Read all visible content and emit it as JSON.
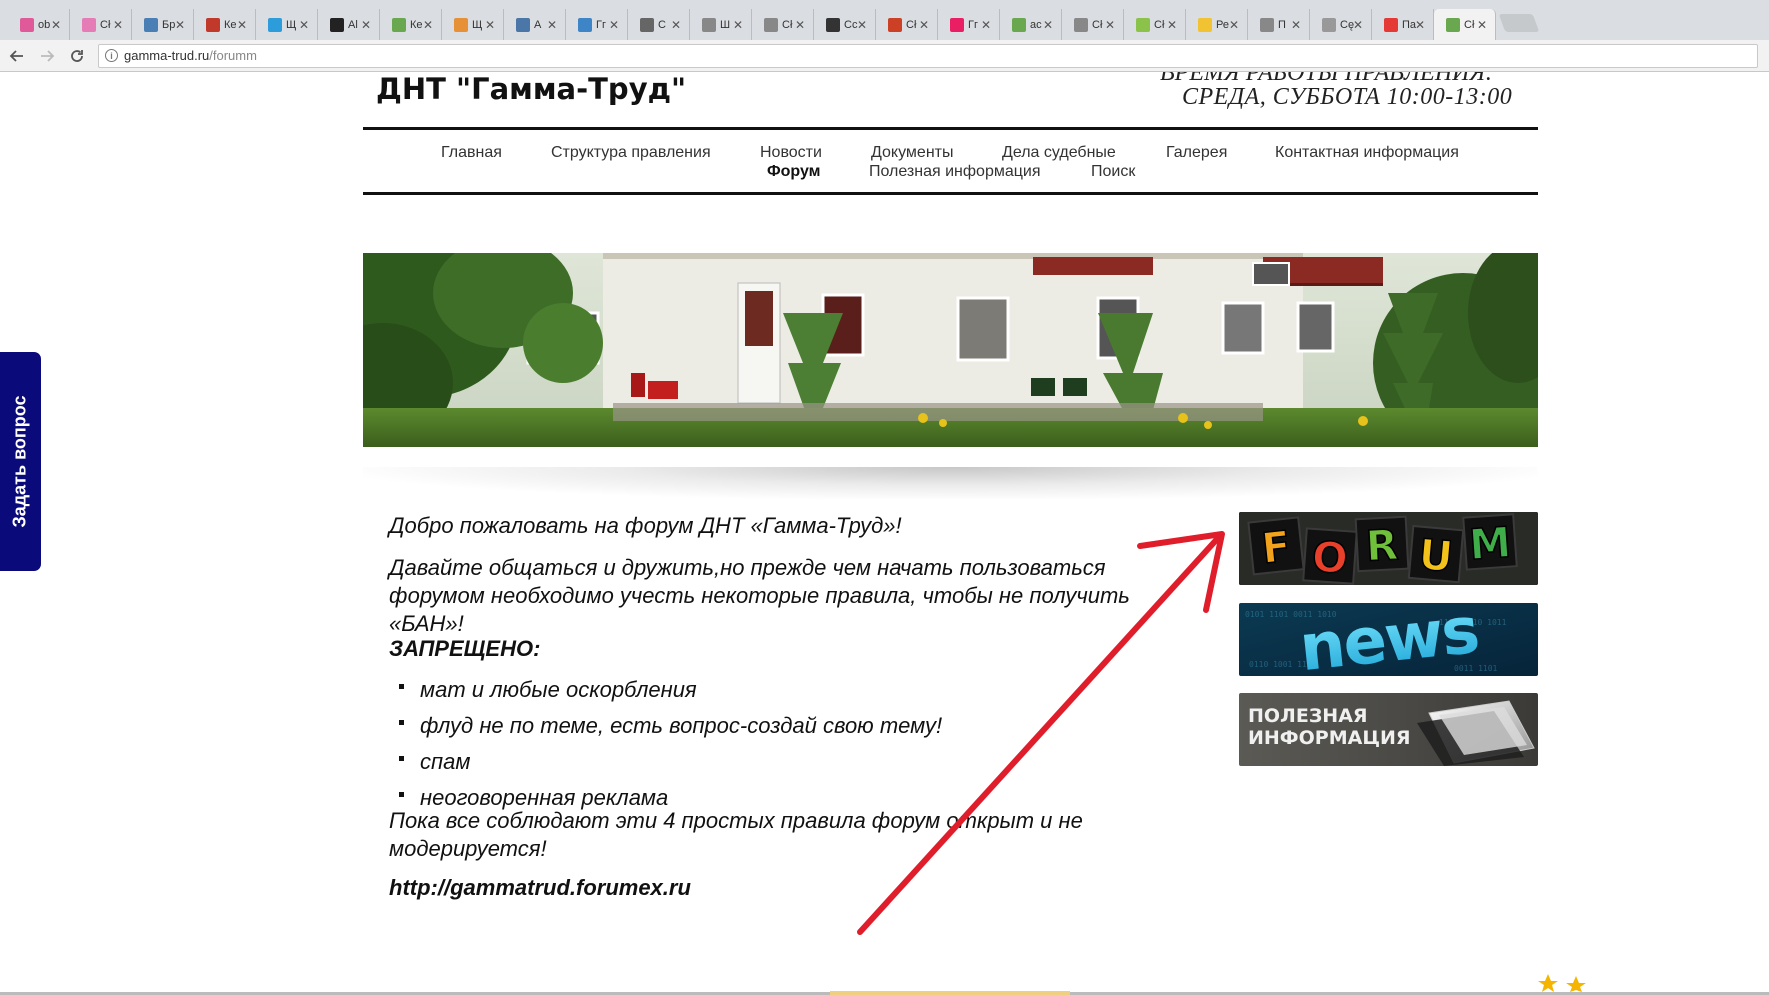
{
  "browser": {
    "tabs": [
      {
        "title": "ob",
        "color": "#e05a9a"
      },
      {
        "title": "Cł",
        "color": "#e57cb6"
      },
      {
        "title": "Бр",
        "color": "#4a7fb5"
      },
      {
        "title": "Ке",
        "color": "#c0392b"
      },
      {
        "title": "Щ",
        "color": "#2d9cdb"
      },
      {
        "title": "Al",
        "color": "#222222"
      },
      {
        "title": "Ке",
        "color": "#6aa84f"
      },
      {
        "title": "Щ",
        "color": "#e69138"
      },
      {
        "title": "А",
        "color": "#4a76a8"
      },
      {
        "title": "Гг",
        "color": "#3d85c6"
      },
      {
        "title": "С",
        "color": "#666666"
      },
      {
        "title": "Ш",
        "color": "#888888"
      },
      {
        "title": "Cł",
        "color": "#888888"
      },
      {
        "title": "Cc",
        "color": "#333333"
      },
      {
        "title": "Cł",
        "color": "#cc4125"
      },
      {
        "title": "Гг",
        "color": "#e91e63"
      },
      {
        "title": "ac",
        "color": "#6aa84f"
      },
      {
        "title": "Cł",
        "color": "#888888"
      },
      {
        "title": "Cł",
        "color": "#8bc34a"
      },
      {
        "title": "Ре",
        "color": "#f1c232"
      },
      {
        "title": "П",
        "color": "#888888"
      },
      {
        "title": "Cę",
        "color": "#999999"
      },
      {
        "title": "Па",
        "color": "#e53935"
      },
      {
        "title": "Cł",
        "color": "#6aa84f",
        "active": true
      }
    ],
    "url_host": "gamma-trud.ru",
    "url_path": "/forumm",
    "back_icon": "arrow-left-icon",
    "forward_icon": "arrow-right-icon",
    "reload_icon": "reload-icon"
  },
  "header": {
    "site_title": "ДНТ \"Гамма-Труд\"",
    "hours_line1": "ВРЕМЯ РАБОТЫ ПРАВЛЕНИЯ:",
    "hours_line2": "СРЕДА, СУББОТА 10:00-13:00"
  },
  "menu": {
    "items": [
      {
        "label": "Главная"
      },
      {
        "label": "Структура правления"
      },
      {
        "label": "Новости"
      },
      {
        "label": "Документы"
      },
      {
        "label": "Дела судебные"
      },
      {
        "label": "Галерея"
      },
      {
        "label": "Контактная информация"
      },
      {
        "label": "Форум",
        "current": true
      },
      {
        "label": "Полезная информация"
      },
      {
        "label": "Поиск"
      }
    ]
  },
  "content": {
    "welcome": "Добро пожаловать на форум ДНТ «Гамма-Труд»!",
    "intro": "Давайте общаться и дружить,но прежде чем начать пользоваться форумом необходимо учесть некоторые правила, чтобы не получить «БАН»!",
    "forbidden_heading": "ЗАПРЕЩЕНО:",
    "rules": [
      "мат и любые оскорбления",
      "флуд не по теме, есть вопрос-создай свою тему!",
      "спам",
      "неоговоренная реклама"
    ],
    "closing": "Пока все соблюдают эти 4 простых правила форум открыт и не модерируется!",
    "forum_url": "http://gammatrud.forumex.ru"
  },
  "sidebar": {
    "forum_letters": [
      "F",
      "O",
      "R",
      "U",
      "M"
    ],
    "forum_colors": [
      "#f2a31b",
      "#e8402a",
      "#6fbf3a",
      "#f2c21b",
      "#3fae4a"
    ],
    "news_label": "news",
    "useful_line1": "ПОЛЕЗНАЯ",
    "useful_line2": "ИНФОРМАЦИЯ"
  },
  "ask_question": {
    "label": "Задать вопрос"
  }
}
